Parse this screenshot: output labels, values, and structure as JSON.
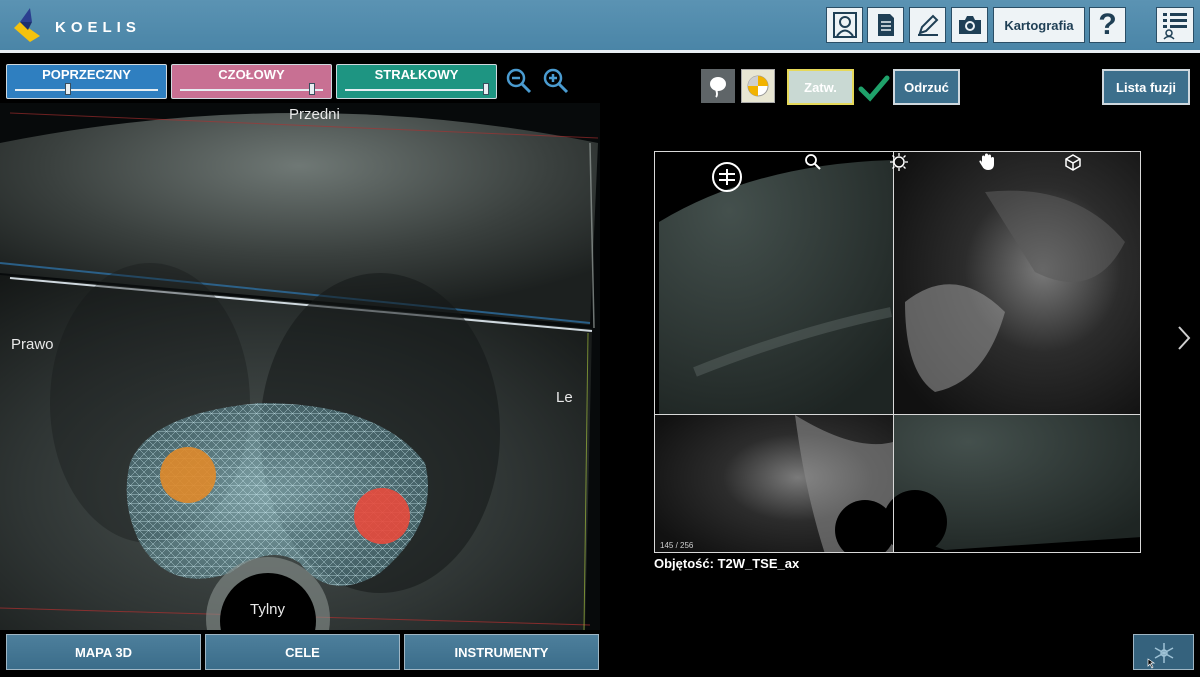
{
  "app": {
    "logo_text": "KOELIS"
  },
  "header": {
    "buttons": [
      {
        "name": "patient-icon"
      },
      {
        "name": "report-icon"
      },
      {
        "name": "pencil-icon"
      },
      {
        "name": "camera-icon"
      },
      {
        "name": "kartografia",
        "label": "Kartografia"
      },
      {
        "name": "help-icon",
        "label": "?"
      },
      {
        "name": "list-user-icon"
      }
    ]
  },
  "views": {
    "poprzeczny": {
      "label": "POPRZECZNY",
      "color": "#2f7fc0",
      "slider": 0.42
    },
    "czolowy": {
      "label": "CZOŁOWY",
      "color": "#c87093",
      "slider": 0.88
    },
    "strzalkowy": {
      "label": "STRAŁKOWY",
      "color": "#1e9582",
      "slider": 0.96
    }
  },
  "toolbar": {
    "zoom_out": "zoom-out-icon",
    "zoom_in": "zoom-in-icon",
    "confirm_label": "Zatw.",
    "reject_label": "Odrzuć",
    "fusion_list_label": "Lista fuzji"
  },
  "view3d": {
    "labels": {
      "anterior": "Przedni",
      "right": "Prawo",
      "left": "Le",
      "posterior": "Tylny"
    },
    "targets": [
      {
        "name": "target-orange",
        "color": "#e08a2a"
      },
      {
        "name": "target-red",
        "color": "#e84a3c"
      }
    ]
  },
  "fusion": {
    "tools": [
      "align-icon",
      "search-icon",
      "brightness-icon",
      "hand-icon",
      "rotate-3d-icon"
    ],
    "slice": "145 / 256",
    "volume_label": "Objętość: T2W_TSE_ax"
  },
  "bottom": {
    "buttons": [
      "MAPA 3D",
      "CELE",
      "INSTRUMENTY"
    ]
  },
  "colors": {
    "header": "#4f89ab",
    "button": "#3c6f8c",
    "check": "#1fa16a"
  }
}
